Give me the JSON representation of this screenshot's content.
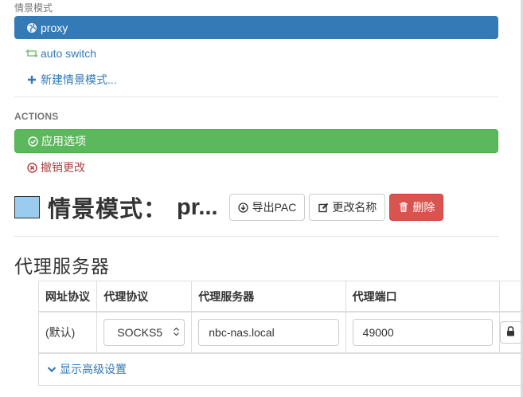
{
  "sidebar": {
    "profiles_header": "情景模式",
    "profiles": [
      {
        "label": "proxy",
        "icon": "globe-icon",
        "active": true
      },
      {
        "label": "auto switch",
        "icon": "retweet-icon",
        "active": false
      },
      {
        "label": "新建情景模式...",
        "icon": "plus-icon",
        "active": false
      }
    ],
    "actions_header": "ACTIONS",
    "actions": [
      {
        "label": "应用选项",
        "icon": "check-circle-icon"
      },
      {
        "label": "撤销更改",
        "icon": "x-circle-icon"
      }
    ]
  },
  "profile": {
    "title": "情景模式：",
    "name": "pr...",
    "color": "#99ccee",
    "buttons": {
      "export": "导出PAC",
      "rename": "更改名称",
      "delete": "删除"
    }
  },
  "proxy_section": {
    "title": "代理服务器",
    "columns": [
      "网址协议",
      "代理协议",
      "代理服务器",
      "代理端口"
    ],
    "row": {
      "scheme": "(默认)",
      "protocol": "SOCKS5",
      "server": "nbc-nas.local",
      "port": "49000"
    },
    "advanced_toggle": "显示高级设置"
  },
  "colors": {
    "primary": "#337ab7",
    "success": "#5cb85c",
    "danger": "#d9534f",
    "danger_text": "#a94442",
    "autoswitch_icon": "#7fc47f"
  }
}
